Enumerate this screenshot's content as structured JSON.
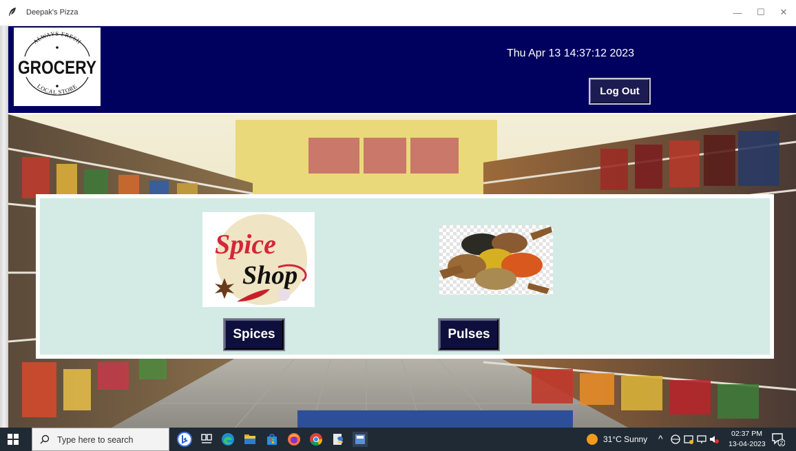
{
  "window": {
    "title": "Deepak's Pizza",
    "controls": {
      "minimize": "—",
      "maximize": "☐",
      "close": "✕"
    }
  },
  "header": {
    "logo": {
      "text": "GROCERY",
      "top_arc": "ALWAYS FRESH",
      "bottom_arc": "LOCAL STORE"
    },
    "datetime": "Thu Apr 13 14:37:12 2023",
    "logout_label": "Log Out"
  },
  "categories": [
    {
      "label": "Spices",
      "image_text_top": "Spice",
      "image_text_bottom": "Shop"
    },
    {
      "label": "Pulses"
    }
  ],
  "taskbar": {
    "search_placeholder": "Type here to search",
    "weather": "31°C Sunny",
    "time": "02:37 PM",
    "date": "13-04-2023",
    "notifications": "2",
    "tray_arrow": "^"
  },
  "colors": {
    "header_bg": "#00005e",
    "panel_bg": "#d3ebe4",
    "button_bg": "#0e0f3c",
    "taskbar_bg": "#1f2a35"
  }
}
